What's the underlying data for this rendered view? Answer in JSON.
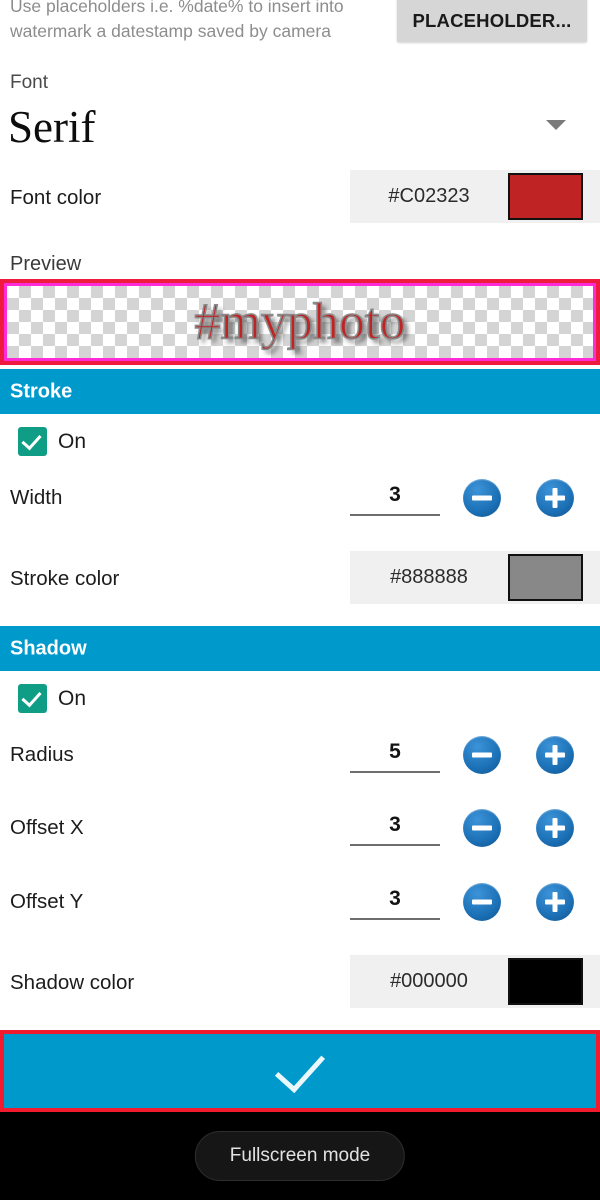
{
  "hint": {
    "text": "Use placeholders i.e. %date% to insert into\nwatermark a datestamp saved by camera",
    "button_label": "PLACEHOLDER..."
  },
  "font": {
    "label": "Font",
    "value": "Serif",
    "caret_icon": "chevron-down-icon"
  },
  "font_color": {
    "label": "Font color",
    "hex": "#C02323",
    "swatch_color": "#C02323"
  },
  "preview": {
    "label": "Preview",
    "text": "#myphoto",
    "highlight_color": "#EF1B3E",
    "inner_border_color": "#FF2BD6"
  },
  "stroke": {
    "header": "Stroke",
    "header_color": "#0099CC",
    "enabled_label": "On",
    "enabled": true,
    "width": {
      "label": "Width",
      "value": "3"
    },
    "color": {
      "label": "Stroke color",
      "hex": "#888888",
      "swatch_color": "#888888"
    }
  },
  "shadow": {
    "header": "Shadow",
    "header_color": "#0099CC",
    "enabled_label": "On",
    "enabled": true,
    "radius": {
      "label": "Radius",
      "value": "5"
    },
    "offset_x": {
      "label": "Offset X",
      "value": "3"
    },
    "offset_y": {
      "label": "Offset Y",
      "value": "3"
    },
    "color": {
      "label": "Shadow color",
      "hex": "#000000",
      "swatch_color": "#000000"
    }
  },
  "stepper": {
    "decrement_icon": "minus-circle-icon",
    "increment_icon": "plus-circle-icon"
  },
  "confirm": {
    "icon": "check-icon",
    "background": "#0099CC",
    "highlight_color": "#F21B2E"
  },
  "navbar": {
    "fullscreen_label": "Fullscreen mode"
  }
}
